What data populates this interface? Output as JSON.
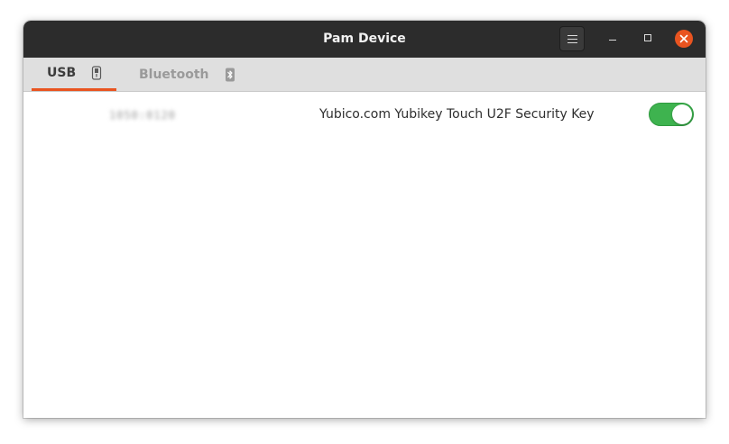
{
  "window": {
    "title": "Pam Device"
  },
  "tabs": [
    {
      "label": "USB",
      "icon": "usb-drive-icon",
      "active": true
    },
    {
      "label": "Bluetooth",
      "icon": "bluetooth-icon",
      "active": false
    }
  ],
  "devices": [
    {
      "id": "1050:0120",
      "name": "Yubico.com Yubikey Touch U2F Security Key",
      "enabled": true
    }
  ],
  "colors": {
    "titlebar": "#2c2c2c",
    "accent": "#e95420",
    "toggle_on": "#3eb34f",
    "tabbar": "#dfdfdf"
  }
}
